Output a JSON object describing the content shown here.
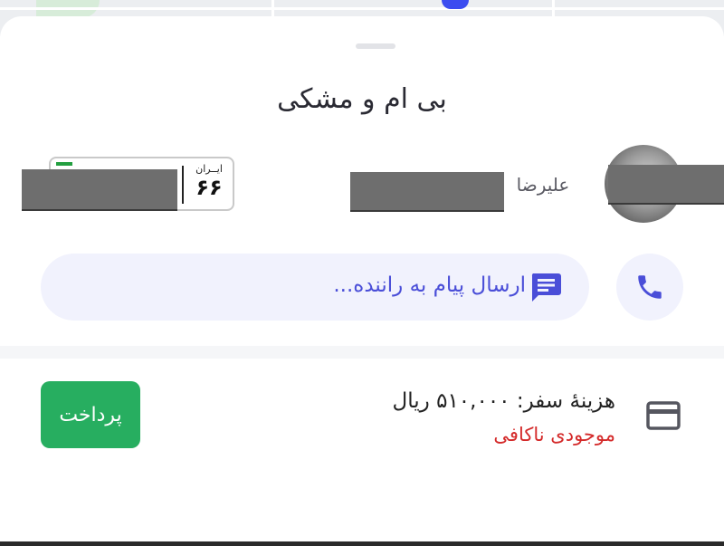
{
  "car": {
    "title": "بی ام و مشکی"
  },
  "plate": {
    "country": "ایــران",
    "region_code": "۶۶"
  },
  "driver": {
    "name": "علیرضا"
  },
  "message": {
    "placeholder": "ارسال پیام به راننده..."
  },
  "payment": {
    "fare_text": "هزینهٔ سفر: ۵۱۰,۰۰۰ ریال",
    "balance_status": "موجودی ناکافی",
    "pay_label": "پرداخت"
  },
  "icons": {
    "message": "chat-icon",
    "call": "phone-icon",
    "card": "credit-card-icon"
  },
  "colors": {
    "accent": "#4a4ed8",
    "pay_button": "#27ae60",
    "warning": "#d42a2a",
    "pill_bg": "#f1f2fd"
  }
}
